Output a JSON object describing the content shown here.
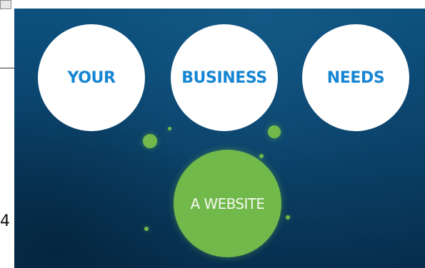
{
  "page": {
    "number": "4"
  },
  "slide": {
    "circles": [
      {
        "label": "YOUR",
        "color": "#1685d3"
      },
      {
        "label": "BUSINESS",
        "color": "#1685d3"
      },
      {
        "label": "NEEDS",
        "color": "#1685d3"
      },
      {
        "label": "A WEBSITE",
        "color": "#72b94b"
      }
    ]
  },
  "icons": {
    "corner": "window-control-icon"
  },
  "colors": {
    "background": "#093f66",
    "accent_blue": "#1685d3",
    "accent_green": "#72b94b",
    "white": "#ffffff"
  }
}
